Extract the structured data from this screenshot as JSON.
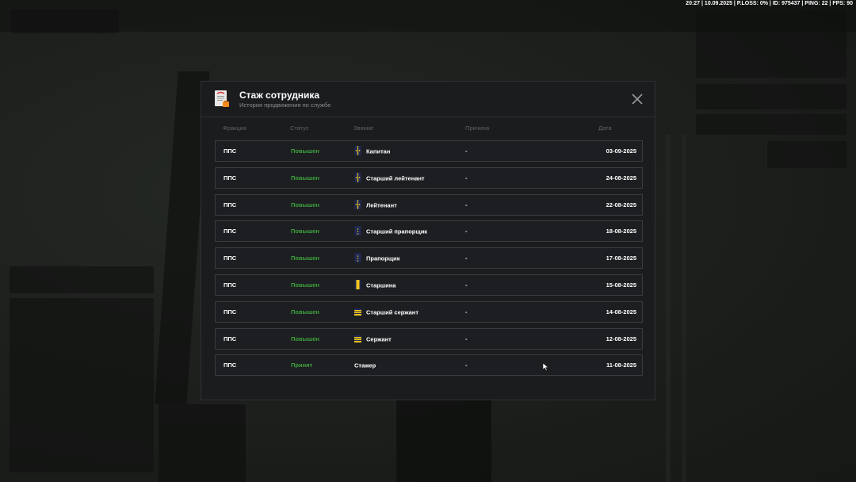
{
  "hud": {
    "status_line": "20:27 | 10.09.2025 | P.LOSS: 0% | ID: 975437 | PING: 22 | FPS: 90"
  },
  "modal": {
    "title": "Стаж сотрудника",
    "subtitle": "История продвижения по службе",
    "icon": "document-icon",
    "close_icon": "close-icon"
  },
  "columns": {
    "faction": "Фракция",
    "status": "Статус",
    "rank": "Звание",
    "reason": "Причина",
    "date": "Дата"
  },
  "colors": {
    "status_green": "#3ea33e",
    "rank_gold": "#f5c518",
    "rank_navy": "#1e2a55"
  },
  "rows": [
    {
      "faction": "ППС",
      "status": "Повышен",
      "rank": "Капитан",
      "reason": "-",
      "date": "03-09-2025",
      "rank_icon": "officer-shoulder-strap-icon"
    },
    {
      "faction": "ППС",
      "status": "Повышен",
      "rank": "Старший лейтенант",
      "reason": "-",
      "date": "24-08-2025",
      "rank_icon": "officer-shoulder-strap-icon"
    },
    {
      "faction": "ППС",
      "status": "Повышен",
      "rank": "Лейтенант",
      "reason": "-",
      "date": "22-08-2025",
      "rank_icon": "officer-shoulder-strap-icon"
    },
    {
      "faction": "ППС",
      "status": "Повышен",
      "rank": "Старший прапорщик",
      "reason": "-",
      "date": "18-08-2025",
      "rank_icon": "warrant-shoulder-strap-icon"
    },
    {
      "faction": "ППС",
      "status": "Повышен",
      "rank": "Прапорщик",
      "reason": "-",
      "date": "17-08-2025",
      "rank_icon": "warrant-shoulder-strap-icon"
    },
    {
      "faction": "ППС",
      "status": "Повышен",
      "rank": "Старшина",
      "reason": "-",
      "date": "15-08-2025",
      "rank_icon": "sergeant-major-shoulder-strap-icon"
    },
    {
      "faction": "ППС",
      "status": "Повышен",
      "rank": "Старший сержант",
      "reason": "-",
      "date": "14-08-2025",
      "rank_icon": "sergeant-shoulder-strap-icon"
    },
    {
      "faction": "ППС",
      "status": "Повышен",
      "rank": "Сержант",
      "reason": "-",
      "date": "12-08-2025",
      "rank_icon": "sergeant-shoulder-strap-icon"
    },
    {
      "faction": "ППС",
      "status": "Принят",
      "rank": "Стажер",
      "reason": "-",
      "date": "11-08-2025",
      "rank_icon": ""
    }
  ]
}
